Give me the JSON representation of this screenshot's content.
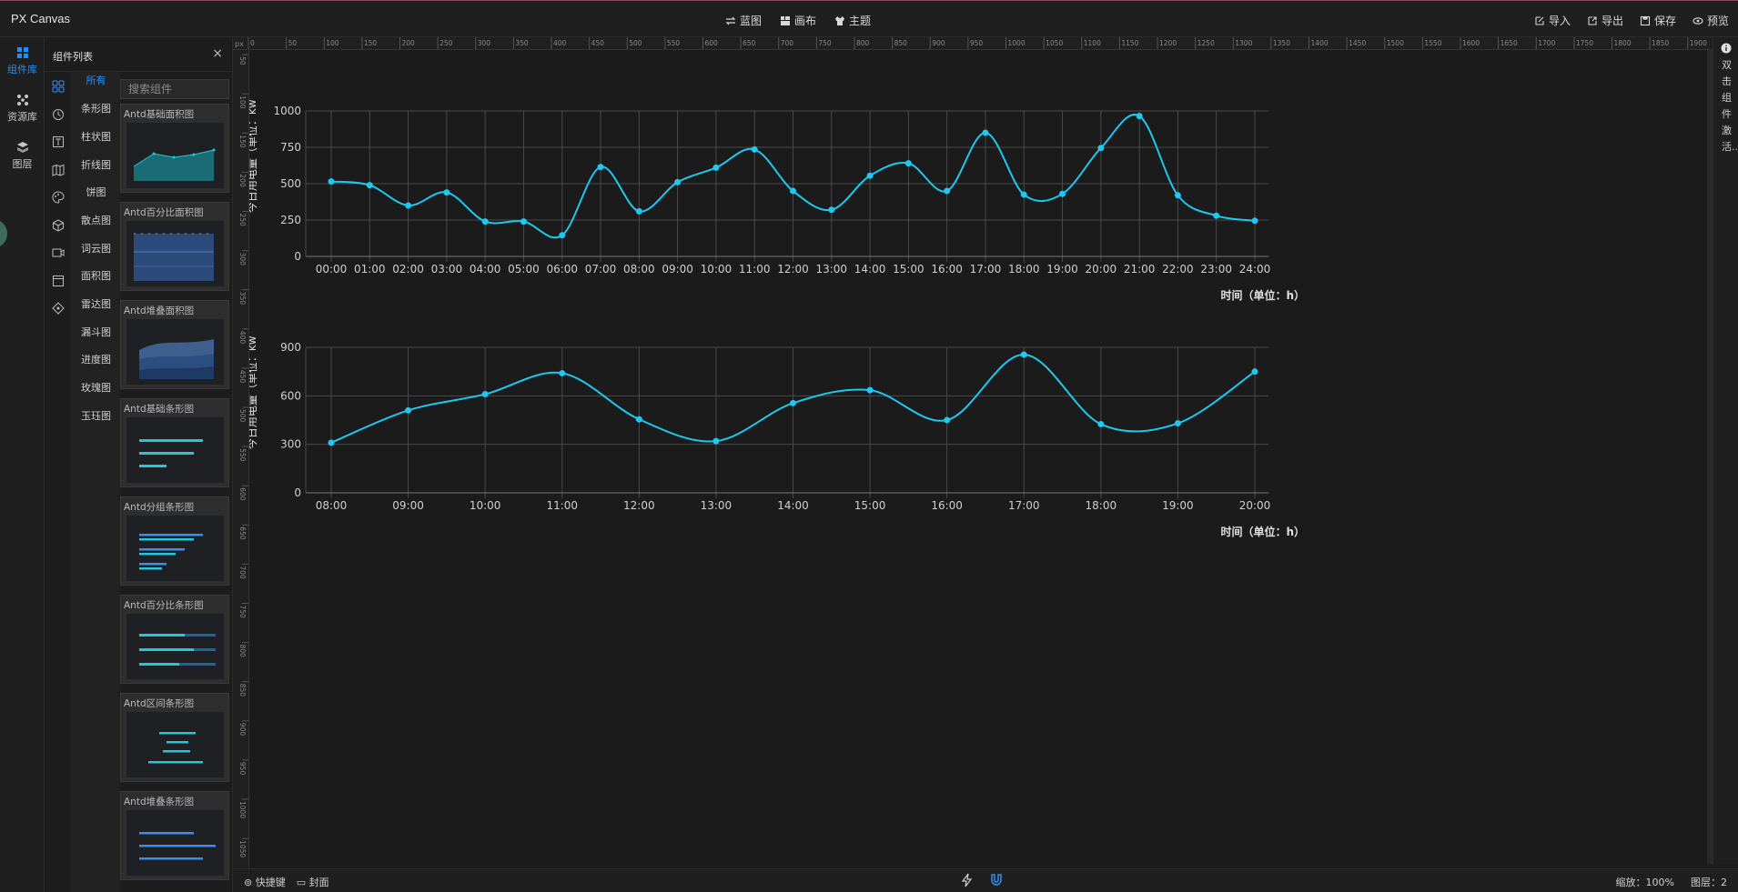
{
  "app": {
    "title": "PX Canvas"
  },
  "header": {
    "center_menu": [
      {
        "label": "蓝图",
        "icon": "swap-icon"
      },
      {
        "label": "画布",
        "icon": "layout-icon"
      },
      {
        "label": "主题",
        "icon": "shirt-icon"
      }
    ],
    "right_menu": [
      {
        "label": "导入",
        "icon": "import-icon"
      },
      {
        "label": "导出",
        "icon": "export-icon"
      },
      {
        "label": "保存",
        "icon": "save-icon"
      },
      {
        "label": "预览",
        "icon": "eye-icon"
      }
    ]
  },
  "rail": {
    "items": [
      {
        "label": "组件库",
        "icon": "grid-icon",
        "active": true
      },
      {
        "label": "资源库",
        "icon": "nodes-icon",
        "active": false
      },
      {
        "label": "图层",
        "icon": "layers-icon",
        "active": false
      }
    ]
  },
  "panel": {
    "title": "组件列表",
    "close": "×",
    "search_placeholder": "搜索组件",
    "category_icons": [
      "apps-icon",
      "clock-icon",
      "text-icon",
      "map-icon",
      "palette-icon",
      "cube-icon",
      "video-icon",
      "window-icon",
      "diamond-icon"
    ],
    "categories": [
      {
        "label": "所有",
        "active": true
      },
      {
        "label": "条形图"
      },
      {
        "label": "柱状图"
      },
      {
        "label": "折线图"
      },
      {
        "label": "饼图"
      },
      {
        "label": "散点图"
      },
      {
        "label": "词云图"
      },
      {
        "label": "面积图"
      },
      {
        "label": "雷达图"
      },
      {
        "label": "漏斗图"
      },
      {
        "label": "进度图"
      },
      {
        "label": "玫瑰图"
      },
      {
        "label": "玉珏图"
      }
    ],
    "cards": [
      {
        "title": "Antd基础面积图"
      },
      {
        "title": "Antd百分比面积图"
      },
      {
        "title": "Antd堆叠面积图"
      },
      {
        "title": "Antd基础条形图"
      },
      {
        "title": "Antd分组条形图"
      },
      {
        "title": "Antd百分比条形图"
      },
      {
        "title": "Antd区间条形图"
      },
      {
        "title": "Antd堆叠条形图"
      }
    ]
  },
  "rulers": {
    "unit": "px",
    "h_ticks": [
      0,
      50,
      100,
      150,
      200,
      250,
      300,
      350,
      400,
      450,
      500,
      550,
      600,
      650,
      700,
      750,
      800,
      850,
      900,
      950,
      1000,
      1050,
      1100,
      1150,
      1200,
      1250,
      1300,
      1350,
      1400,
      1450,
      1500,
      1550,
      1600,
      1650,
      1700,
      1750,
      1800,
      1850,
      1900
    ],
    "v_ticks": [
      50,
      100,
      150,
      200,
      250,
      300,
      350,
      400,
      450,
      500,
      550,
      600,
      650,
      700,
      750,
      800,
      850,
      900,
      950,
      1000,
      1050
    ]
  },
  "right_hint": "双击组件激活...",
  "statusbar": {
    "shortcuts": "快捷键",
    "cover": "封面",
    "zoom": "缩放：100%",
    "layers": "图层：2"
  },
  "chart_data": [
    {
      "type": "line",
      "ylabel": "今日用电量（单位：kwh）",
      "xlabel": "时间（单位：h）",
      "ylim": [
        0,
        1000
      ],
      "yticks": [
        0,
        250,
        500,
        750,
        1000
      ],
      "color": "#1ec8f0",
      "smooth": true,
      "grid": true,
      "categories": [
        "00:00",
        "01:00",
        "02:00",
        "03:00",
        "04:00",
        "05:00",
        "06:00",
        "07:00",
        "08:00",
        "09:00",
        "10:00",
        "11:00",
        "12:00",
        "13:00",
        "14:00",
        "15:00",
        "16:00",
        "17:00",
        "18:00",
        "19:00",
        "20:00",
        "21:00",
        "22:00",
        "23:00",
        "24:00"
      ],
      "values": [
        515,
        490,
        350,
        440,
        240,
        240,
        145,
        615,
        310,
        510,
        610,
        735,
        450,
        320,
        555,
        640,
        450,
        850,
        425,
        430,
        745,
        965,
        420,
        280,
        245
      ]
    },
    {
      "type": "line",
      "ylabel": "今日用电量（单位：kwh）",
      "xlabel": "时间（单位：h）",
      "ylim": [
        0,
        900
      ],
      "yticks": [
        0,
        300,
        600,
        900
      ],
      "color": "#1ec8f0",
      "smooth": true,
      "grid": true,
      "categories": [
        "08:00",
        "09:00",
        "10:00",
        "11:00",
        "12:00",
        "13:00",
        "14:00",
        "15:00",
        "16:00",
        "17:00",
        "18:00",
        "19:00",
        "20:00"
      ],
      "values": [
        310,
        510,
        610,
        740,
        455,
        320,
        555,
        635,
        450,
        855,
        425,
        430,
        750
      ]
    }
  ]
}
